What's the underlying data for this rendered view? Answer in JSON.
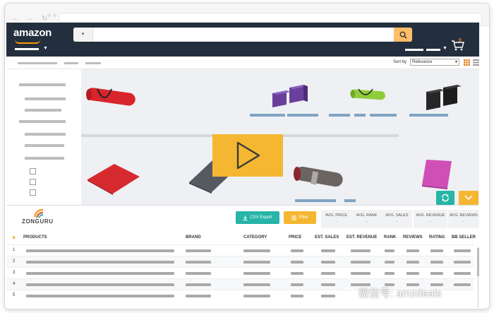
{
  "amazon": {
    "logo": "amazon",
    "search": {
      "category_label": "",
      "placeholder": ""
    },
    "cart_count": "0"
  },
  "toolbar": {
    "sort_by_label": "Sort by",
    "sort_value": "Relevance"
  },
  "zonguru": {
    "logo": "ZONGURU",
    "csv_export_label": "CSV Export",
    "filter_label": "Filter",
    "stats": [
      {
        "label": "AVG. PRICE",
        "value": "-"
      },
      {
        "label": "AVG. RANK",
        "value": "-"
      },
      {
        "label": "AVG. SALES",
        "value": "-"
      },
      {
        "label": "AVG. REVENUE",
        "value": "-"
      },
      {
        "label": "AVG. REVIEWS",
        "value": "-"
      }
    ],
    "table": {
      "columns": [
        "PRODUCTS",
        "BRAND",
        "CATEGORY",
        "PRICE",
        "EST. SALES",
        "EST. REVENUE",
        "RANK",
        "REVIEWS",
        "RATING",
        "BB SELLER"
      ],
      "row_numbers": [
        "1",
        "2",
        "3",
        "4",
        "5"
      ]
    }
  },
  "watermark": {
    "text": "微信号: amzdeals"
  },
  "colors": {
    "amazon_header": "#232f3e",
    "amazon_search_button": "#febd69",
    "teal": "#26b5a6",
    "yellow": "#f5b731"
  },
  "icons": {
    "play": "play-icon",
    "refresh": "refresh-icon",
    "chevron": "chevron-down-icon",
    "cart": "cart-icon",
    "search": "search-icon"
  }
}
